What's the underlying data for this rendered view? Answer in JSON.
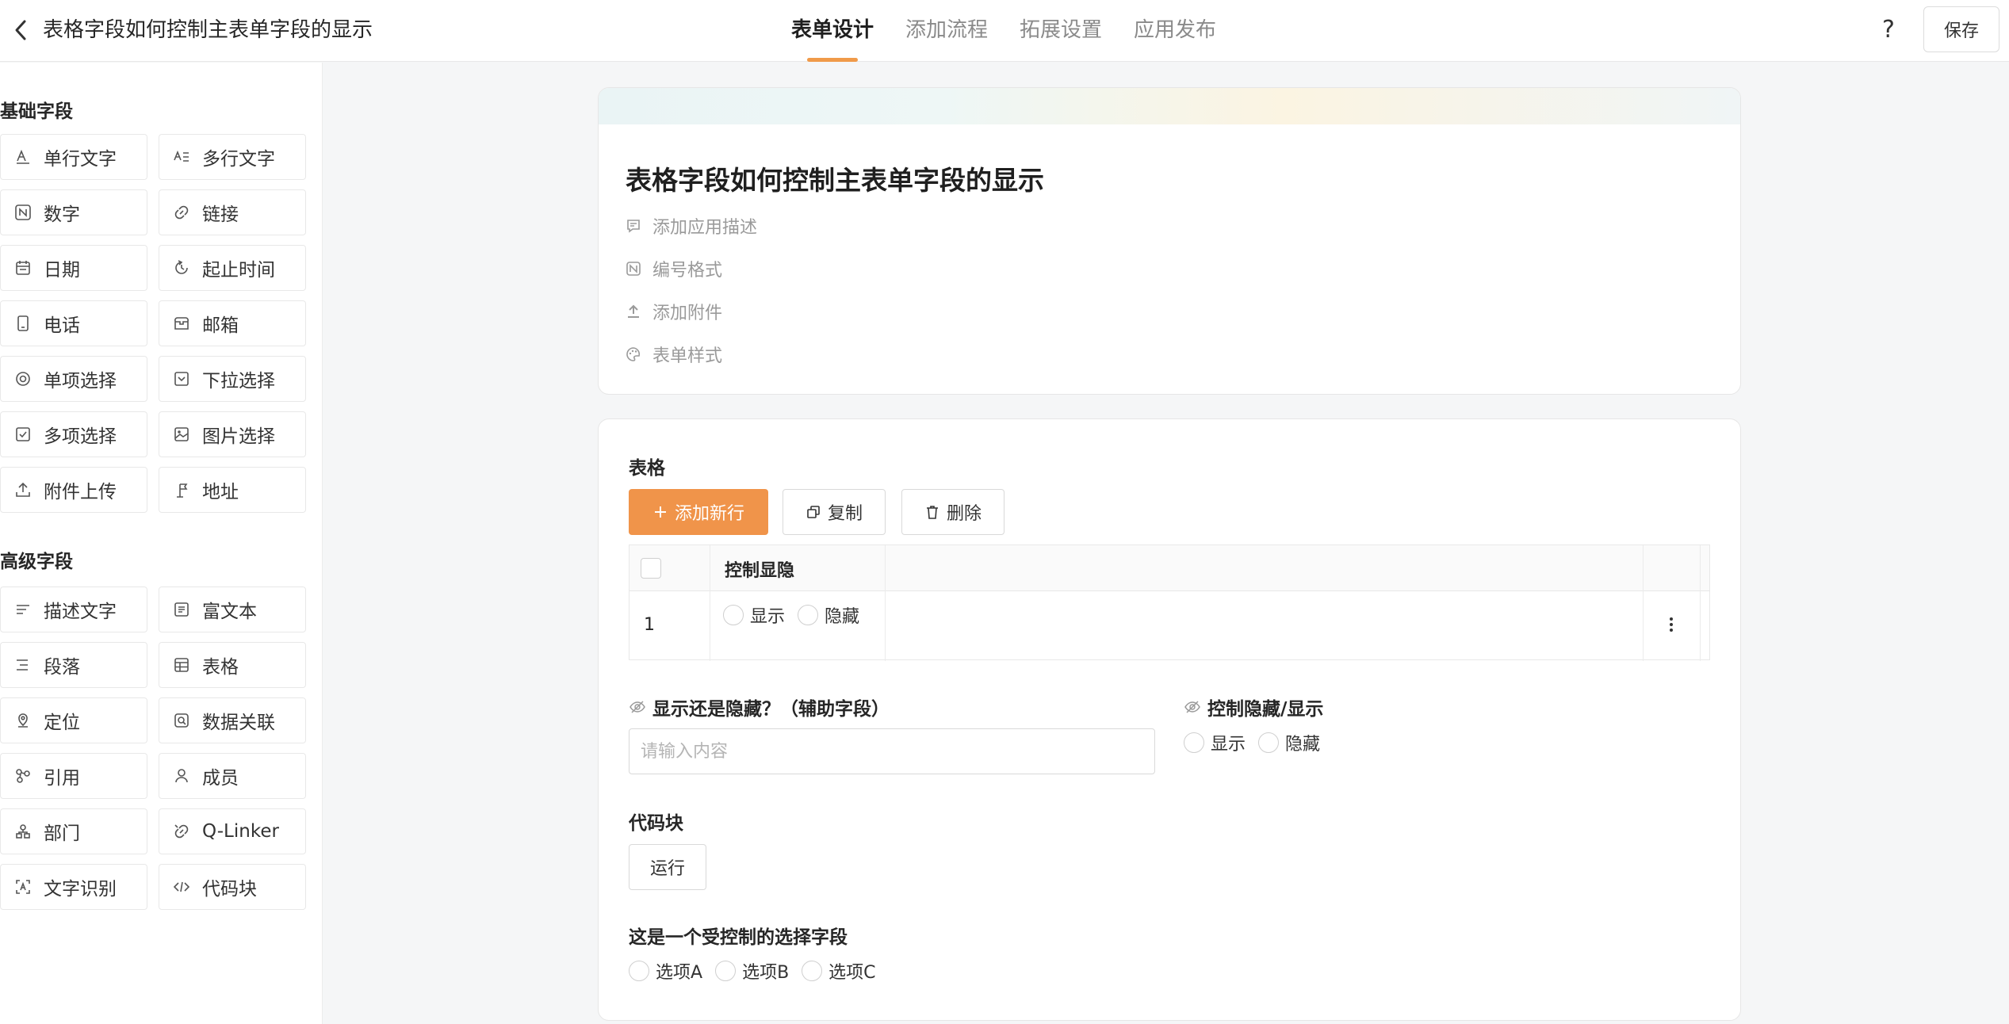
{
  "header": {
    "title": "表格字段如何控制主表单字段的显示",
    "tabs": [
      {
        "label": "表单设计",
        "active": true
      },
      {
        "label": "添加流程",
        "active": false
      },
      {
        "label": "拓展设置",
        "active": false
      },
      {
        "label": "应用发布",
        "active": false
      }
    ],
    "help_label": "?",
    "save_label": "保存",
    "accent_color": "#f0944a"
  },
  "sidebar": {
    "basic_title": "基础字段",
    "basic_fields": [
      {
        "label": "单行文字",
        "icon": "single-line-text-icon"
      },
      {
        "label": "多行文字",
        "icon": "multi-line-text-icon"
      },
      {
        "label": "数字",
        "icon": "number-icon"
      },
      {
        "label": "链接",
        "icon": "link-icon"
      },
      {
        "label": "日期",
        "icon": "calendar-icon"
      },
      {
        "label": "起止时间",
        "icon": "time-range-icon"
      },
      {
        "label": "电话",
        "icon": "phone-icon"
      },
      {
        "label": "邮箱",
        "icon": "mailbox-icon"
      },
      {
        "label": "单项选择",
        "icon": "radio-icon"
      },
      {
        "label": "下拉选择",
        "icon": "dropdown-icon"
      },
      {
        "label": "多项选择",
        "icon": "checkbox-icon"
      },
      {
        "label": "图片选择",
        "icon": "image-icon"
      },
      {
        "label": "附件上传",
        "icon": "upload-icon"
      },
      {
        "label": "地址",
        "icon": "address-icon"
      }
    ],
    "advanced_title": "高级字段",
    "advanced_fields": [
      {
        "label": "描述文字",
        "icon": "description-icon"
      },
      {
        "label": "富文本",
        "icon": "rich-text-icon"
      },
      {
        "label": "段落",
        "icon": "paragraph-icon"
      },
      {
        "label": "表格",
        "icon": "table-icon"
      },
      {
        "label": "定位",
        "icon": "location-icon"
      },
      {
        "label": "数据关联",
        "icon": "data-link-icon"
      },
      {
        "label": "引用",
        "icon": "reference-icon"
      },
      {
        "label": "成员",
        "icon": "member-icon"
      },
      {
        "label": "部门",
        "icon": "department-icon"
      },
      {
        "label": "Q-Linker",
        "icon": "q-linker-icon"
      },
      {
        "label": "文字识别",
        "icon": "ocr-icon"
      },
      {
        "label": "代码块",
        "icon": "code-icon"
      }
    ]
  },
  "form": {
    "title": "表格字段如何控制主表单字段的显示",
    "meta": {
      "description": "添加应用描述",
      "number_format": "编号格式",
      "attachment": "添加附件",
      "style": "表单样式"
    }
  },
  "table_field": {
    "label": "表格",
    "add_row": "添加新行",
    "copy": "复制",
    "delete": "删除",
    "column_header": "控制显隐",
    "row_index": "1",
    "options": [
      "显示",
      "隐藏"
    ]
  },
  "helper_field": {
    "label": "显示还是隐藏？（辅助字段）",
    "placeholder": "请输入内容"
  },
  "control_field": {
    "label": "控制隐藏/显示",
    "options": [
      "显示",
      "隐藏"
    ]
  },
  "code_block": {
    "label": "代码块",
    "run": "运行"
  },
  "controlled_select": {
    "label": "这是一个受控制的选择字段",
    "options": [
      "选项A",
      "选项B",
      "选项C"
    ]
  }
}
